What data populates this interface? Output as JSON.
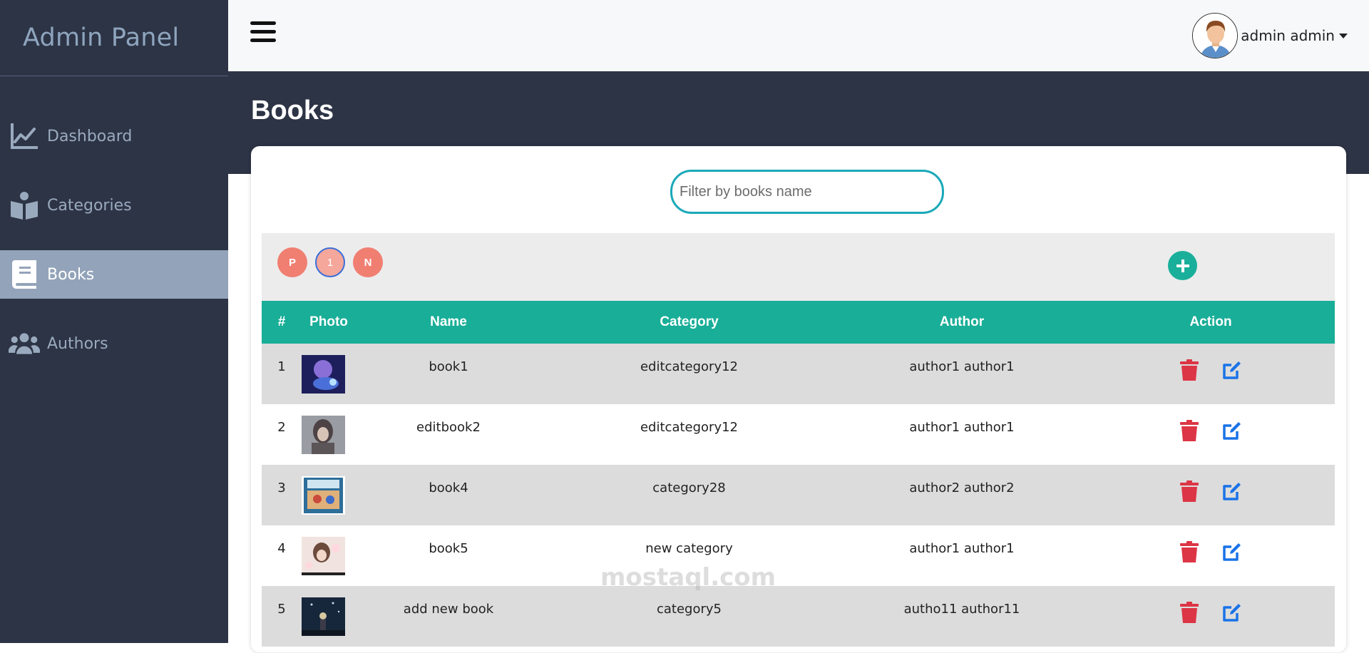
{
  "app": {
    "title": "Admin Panel"
  },
  "sidebar": {
    "items": [
      {
        "label": "Dashboard",
        "icon": "chart-line-icon"
      },
      {
        "label": "Categories",
        "icon": "open-book-icon"
      },
      {
        "label": "Books",
        "icon": "book-icon",
        "active": true
      },
      {
        "label": "Authors",
        "icon": "users-icon"
      }
    ]
  },
  "topbar": {
    "user_name": "admin admin"
  },
  "page": {
    "title": "Books"
  },
  "search": {
    "placeholder": "Filter by books name",
    "value": ""
  },
  "pagination": {
    "prev": "P",
    "current": "1",
    "next": "N"
  },
  "table": {
    "columns": [
      "#",
      "Photo",
      "Name",
      "Category",
      "Author",
      "Action"
    ],
    "rows": [
      {
        "num": "1",
        "name": "book1",
        "category": "editcategory12",
        "author": "author1 author1"
      },
      {
        "num": "2",
        "name": "editbook2",
        "category": "editcategory12",
        "author": "author1 author1"
      },
      {
        "num": "3",
        "name": "book4",
        "category": "category28",
        "author": "author2 author2"
      },
      {
        "num": "4",
        "name": "book5",
        "category": "new category",
        "author": "author1 author1"
      },
      {
        "num": "5",
        "name": "add new book",
        "category": "category5",
        "author": "autho11 author11"
      }
    ]
  },
  "watermark": "mostaql.com",
  "colors": {
    "sidebar_bg": "#2d3446",
    "active_item": "#93a3b9",
    "table_header": "#19ae98",
    "pager": "#f07f72",
    "add_button": "#1aaf9a",
    "delete": "#dc3545",
    "edit": "#1a73e8",
    "search_border": "#1aa9b8"
  }
}
